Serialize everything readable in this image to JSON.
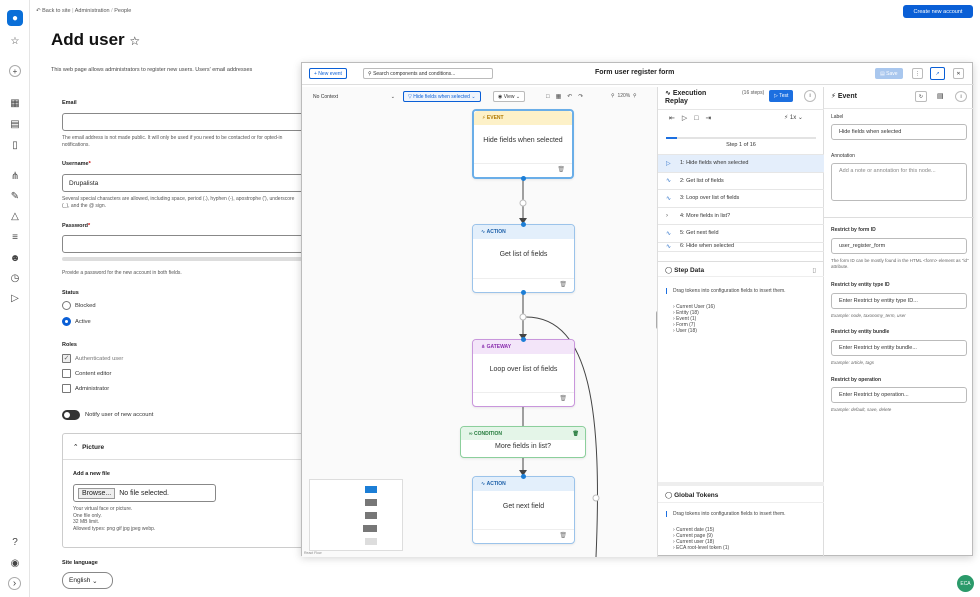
{
  "header": {
    "back_link": "Back to site",
    "breadcrumb": [
      "Administration",
      "People"
    ],
    "create_button": "Create new account",
    "title": "Add user",
    "intro": "This web page allows administrators to register new users. Users' email addresses"
  },
  "form": {
    "email": {
      "label": "Email",
      "value": "",
      "description": "The email address is not made public. It will only be used if you need to be contacted or for opted-in notifications."
    },
    "username": {
      "label": "Username",
      "value": "Drupalista",
      "description": "Several special characters are allowed, including space, period (.), hyphen (-), apostrophe ('), underscore (_), and the @ sign."
    },
    "password": {
      "label": "Password",
      "value": "",
      "description": "Provide a password for the new account in both fields."
    },
    "status": {
      "label": "Status",
      "options": [
        "Blocked",
        "Active"
      ],
      "selected": "Active"
    },
    "roles": {
      "label": "Roles",
      "options": [
        "Authenticated user",
        "Content editor",
        "Administrator"
      ],
      "checked": [
        "Authenticated user"
      ]
    },
    "notify": {
      "label": "Notify user of new account",
      "on": false
    },
    "picture": {
      "title": "Picture",
      "add_label": "Add a new file",
      "browse": "Browse...",
      "no_file": "No file selected.",
      "help": [
        "Your virtual face or picture.",
        "One file only.",
        "32 MB limit.",
        "Allowed types: png gif jpg jpeg webp."
      ]
    },
    "site_language": {
      "label": "Site language",
      "value": "English"
    }
  },
  "modal": {
    "new_event": "+ New event",
    "search_placeholder": "Search components and conditions...",
    "title": "Form user register form",
    "save": "Save",
    "context": "No Context",
    "filter": "Hide fields when selected",
    "view": "View",
    "zoom": "120%",
    "react_flow": "React Flow",
    "nodes": [
      {
        "type": "EVENT",
        "label": "Hide fields when selected"
      },
      {
        "type": "ACTION",
        "label": "Get list of fields"
      },
      {
        "type": "GATEWAY",
        "label": "Loop over list of fields"
      },
      {
        "type": "CONDITION",
        "label": "More fields in list?"
      },
      {
        "type": "ACTION",
        "label": "Get next field"
      }
    ],
    "replay": {
      "title": "Execution Replay",
      "steps_count": "(16 steps)",
      "test": "Test",
      "speed": "1x",
      "step_of": "Step 1 of 16",
      "steps": [
        "1: Hide fields when selected",
        "2: Get list of fields",
        "3: Loop over list of fields",
        "4: More fields in list?",
        "5: Get next field",
        "6: Hide when selected"
      ],
      "step_data_title": "Step Data",
      "drag_hint": "Drag tokens into configuration fields to insert them.",
      "step_tokens": [
        "Current User (16)",
        "Entity (18)",
        "Event (1)",
        "Form (7)",
        "User (18)"
      ],
      "global_title": "Global Tokens",
      "global_tokens": [
        "Current date (15)",
        "Current page (9)",
        "Current user (18)",
        "ECA root-level token (1)"
      ]
    },
    "props": {
      "title": "Event",
      "label_lbl": "Label",
      "label_val": "Hide fields when selected",
      "annotation_lbl": "Annotation",
      "annotation_ph": "Add a note or annotation for this node...",
      "form_id_lbl": "Restrict by form ID",
      "form_id_val": "user_register_form",
      "form_id_help": "The form ID can be mostly found in the HTML <form> element as \"id\" attribute.",
      "entity_type_lbl": "Restrict by entity type ID",
      "entity_type_ph": "Enter Restrict by entity type ID...",
      "entity_type_ex": "Example: node, taxonomy_term, user",
      "bundle_lbl": "Restrict by entity bundle",
      "bundle_ph": "Enter Restrict by entity bundle...",
      "bundle_ex": "Example: article, tags",
      "op_lbl": "Restrict by operation",
      "op_ph": "Enter Restrict by operation...",
      "op_ex": "Example: default, save, delete"
    }
  },
  "fab": "ECA",
  "colors": {
    "accent": "#0a5fd6",
    "event": "#f5b50a",
    "action": "#1c7ed6",
    "gateway": "#a64ac9",
    "condition": "#2b9a4a"
  }
}
